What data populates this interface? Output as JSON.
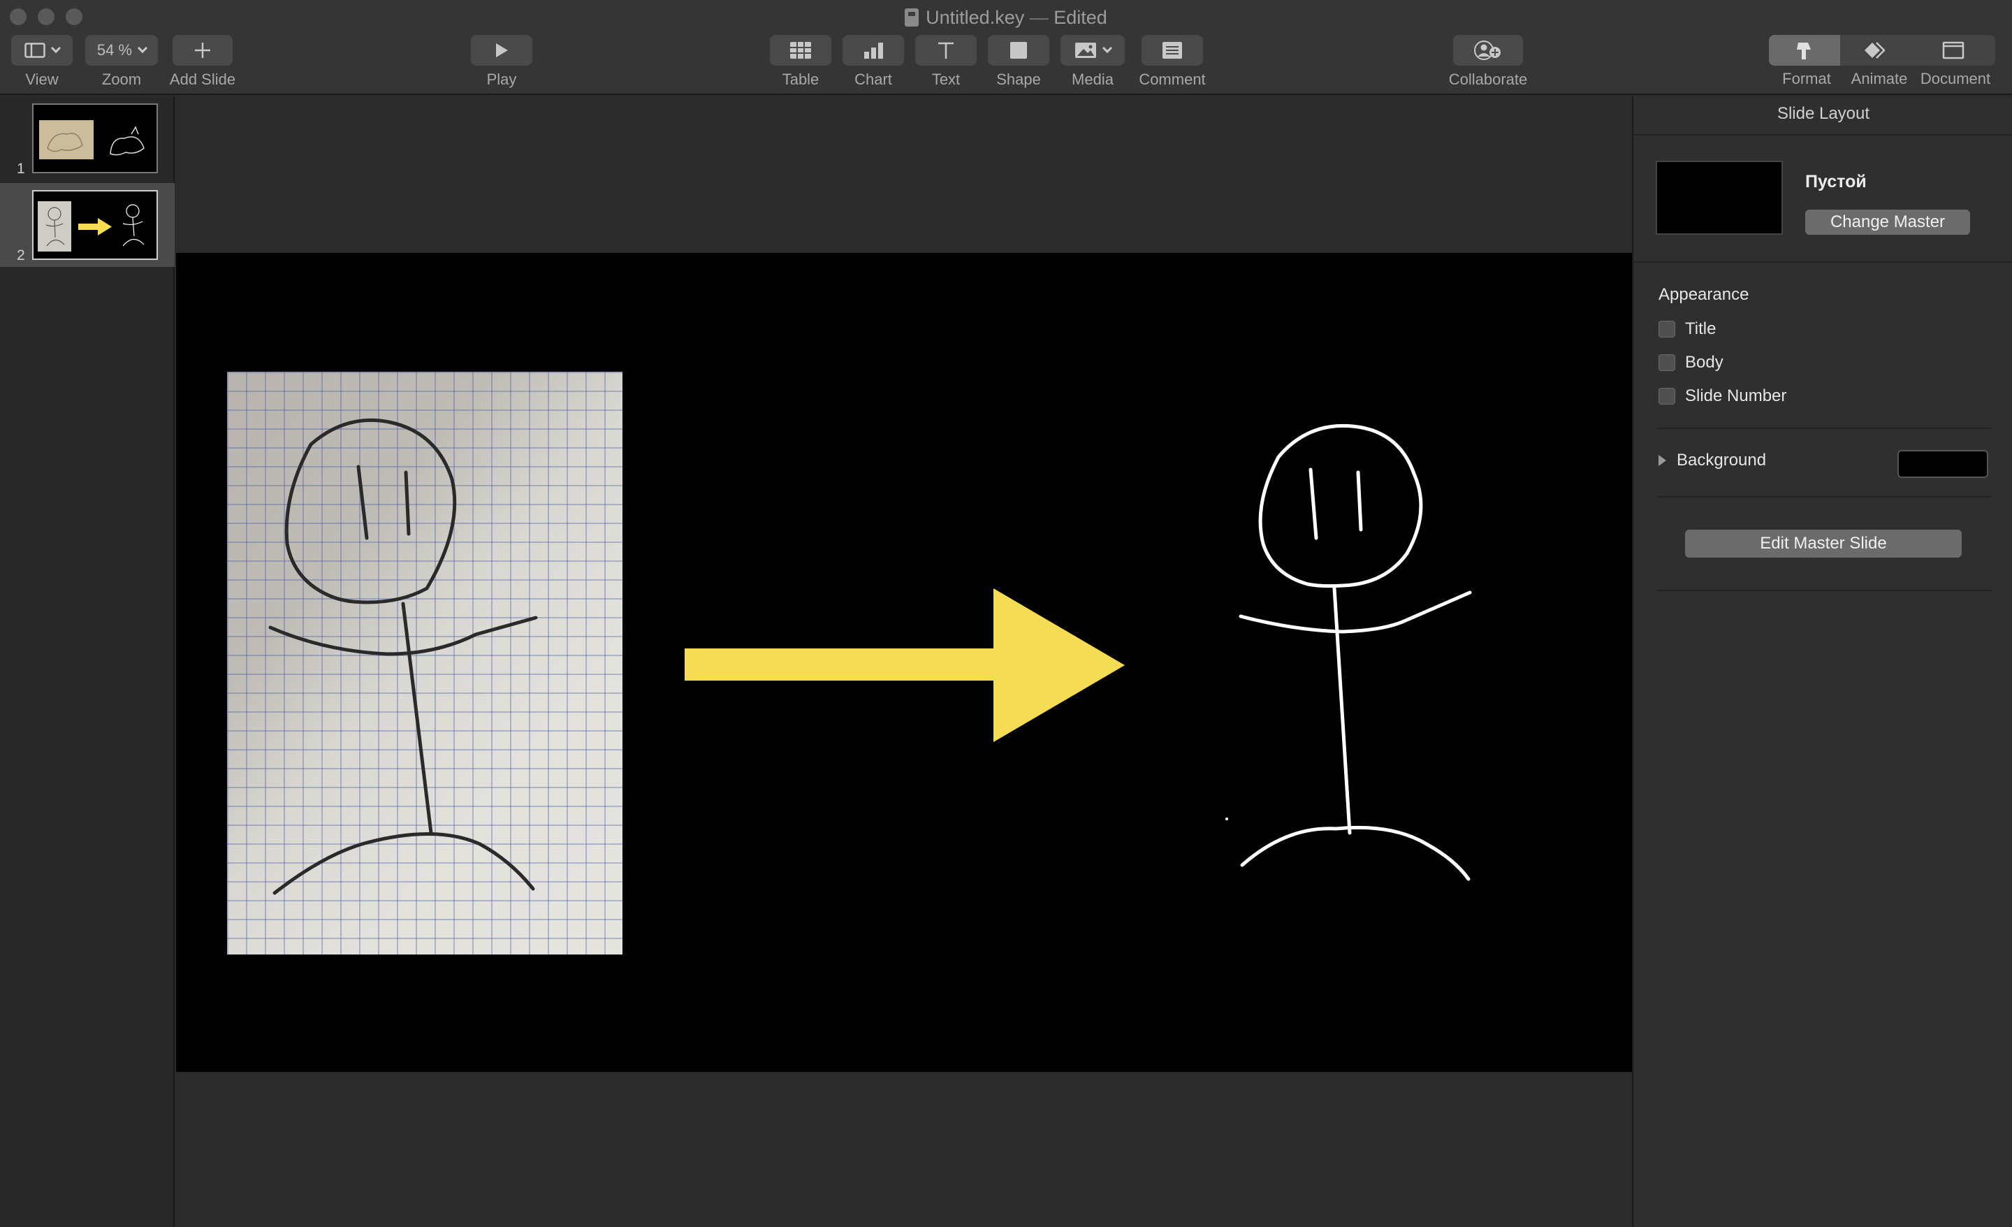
{
  "window": {
    "title": "Untitled.key",
    "separator": "—",
    "status": "Edited"
  },
  "toolbar": {
    "view_label": "View",
    "zoom_value": "54 %",
    "zoom_label": "Zoom",
    "add_slide_label": "Add Slide",
    "play_label": "Play",
    "table_label": "Table",
    "chart_label": "Chart",
    "text_label": "Text",
    "shape_label": "Shape",
    "media_label": "Media",
    "comment_label": "Comment",
    "collaborate_label": "Collaborate",
    "format_label": "Format",
    "animate_label": "Animate",
    "document_label": "Document",
    "active_inspector_tab": "Format"
  },
  "navigator": {
    "slides": [
      {
        "number": "1",
        "selected": false
      },
      {
        "number": "2",
        "selected": true
      }
    ]
  },
  "slide": {
    "background_color": "#000000",
    "arrow_color": "#f5dc55",
    "stroke_dark": "#2a2a2a",
    "stroke_light": "#ffffff"
  },
  "inspector": {
    "header": "Slide Layout",
    "master_name": "Пустой",
    "change_master_label": "Change Master",
    "appearance_heading": "Appearance",
    "checkboxes": [
      {
        "label": "Title",
        "checked": false
      },
      {
        "label": "Body",
        "checked": false
      },
      {
        "label": "Slide Number",
        "checked": false
      }
    ],
    "background_label": "Background",
    "background_color": "#000000",
    "edit_master_label": "Edit Master Slide"
  }
}
